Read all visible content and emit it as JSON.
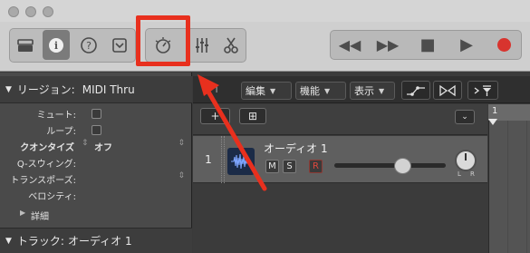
{
  "toolbar": {
    "buttons": [
      {
        "name": "library-icon"
      },
      {
        "name": "inspector-icon"
      },
      {
        "name": "help-icon"
      },
      {
        "name": "toolbar-menu-icon"
      },
      {
        "name": "smart-controls-icon"
      },
      {
        "name": "mixer-icon"
      },
      {
        "name": "editors-icon"
      }
    ],
    "highlight_color": "#e8301e",
    "transport": {
      "rewind": "◀◀",
      "forward": "▶▶",
      "stop": "■",
      "play": "▶",
      "record_color": "#d8342e"
    }
  },
  "inspector": {
    "region_header": "リージョン:",
    "region_name": "MIDI Thru",
    "mute_label": "ミュート:",
    "loop_label": "ループ:",
    "quantize_label": "クオンタイズ",
    "quantize_value": "オフ",
    "qswing_label": "Q-スウィング:",
    "transpose_label": "トランスポーズ:",
    "velocity_label": "ベロシティ:",
    "details_label": "詳細",
    "track_header": "トラック:",
    "track_name": "オーディオ 1"
  },
  "tracks_toolbar": {
    "back_arrow": "↰",
    "edit_menu": "編集",
    "function_menu": "機能",
    "view_menu": "表示"
  },
  "track_header": {
    "new_track_button": "+",
    "global_tracks_button": "⊞"
  },
  "track": {
    "number": "1",
    "name": "オーディオ 1",
    "mute": "M",
    "solo": "S",
    "record": "R",
    "pan_left": "L",
    "pan_right": "R",
    "volume_level": 0.62
  },
  "timeline": {
    "bar_number": "1"
  }
}
